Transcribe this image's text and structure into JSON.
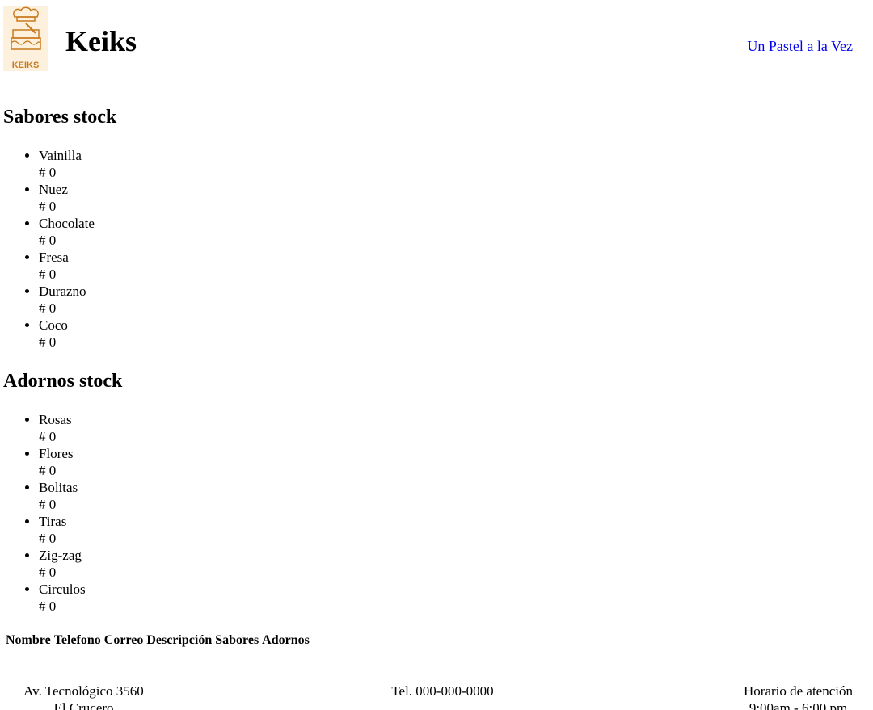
{
  "header": {
    "logo_text": "KEIKS",
    "brand": "Keiks",
    "tagline": "Un Pastel a la Vez"
  },
  "sabores": {
    "title": "Sabores stock",
    "items": [
      {
        "name": "Vainilla",
        "qty": "# 0"
      },
      {
        "name": "Nuez",
        "qty": "# 0"
      },
      {
        "name": "Chocolate",
        "qty": "# 0"
      },
      {
        "name": "Fresa",
        "qty": "# 0"
      },
      {
        "name": "Durazno",
        "qty": "# 0"
      },
      {
        "name": "Coco",
        "qty": "# 0"
      }
    ]
  },
  "adornos": {
    "title": "Adornos stock",
    "items": [
      {
        "name": "Rosas",
        "qty": "# 0"
      },
      {
        "name": "Flores",
        "qty": "# 0"
      },
      {
        "name": "Bolitas",
        "qty": "# 0"
      },
      {
        "name": "Tiras",
        "qty": "# 0"
      },
      {
        "name": "Zig-zag",
        "qty": "# 0"
      },
      {
        "name": "Circulos",
        "qty": "# 0"
      }
    ]
  },
  "orders_table": {
    "headers": [
      "Nombre",
      "Telefono",
      "Correo",
      "Descripción",
      "Sabores",
      "Adornos"
    ]
  },
  "footer": {
    "address_line1": "Av. Tecnológico 3560",
    "address_line2": "El Crucero",
    "phone": "Tel. 000-000-0000",
    "hours_title": "Horario de atención",
    "hours": "9:00am - 6:00 pm"
  },
  "colors": {
    "link": "#0000ee",
    "logo_bg": "#fdf1de",
    "logo_accent": "#c97a1e"
  }
}
